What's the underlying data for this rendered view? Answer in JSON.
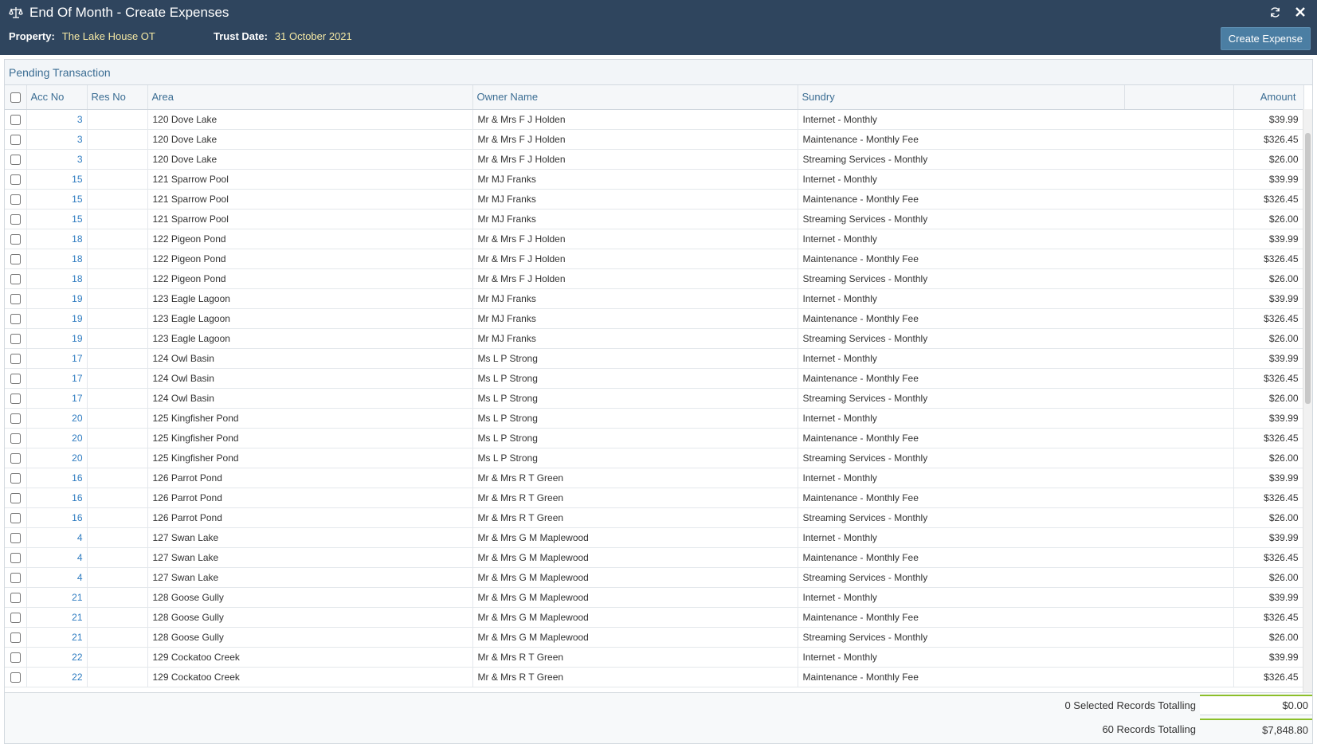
{
  "header": {
    "title": "End Of Month - Create Expenses",
    "property_label": "Property:",
    "property_value": "The Lake House OT",
    "trust_date_label": "Trust Date:",
    "trust_date_value": "31 October 2021",
    "create_button": "Create Expense",
    "icons": [
      "scale-icon",
      "refresh-icon",
      "close-icon"
    ]
  },
  "panel": {
    "title": "Pending Transaction",
    "columns": {
      "acc_no": "Acc No",
      "res_no": "Res No",
      "area": "Area",
      "owner": "Owner Name",
      "sundry": "Sundry",
      "amount": "Amount"
    },
    "rows": [
      {
        "acc": "3",
        "res": "",
        "area": "120 Dove Lake",
        "owner": "Mr & Mrs F J Holden",
        "sundry": "Internet - Monthly",
        "amount": "$39.99"
      },
      {
        "acc": "3",
        "res": "",
        "area": "120 Dove Lake",
        "owner": "Mr & Mrs F J Holden",
        "sundry": "Maintenance - Monthly Fee",
        "amount": "$326.45"
      },
      {
        "acc": "3",
        "res": "",
        "area": "120 Dove Lake",
        "owner": "Mr & Mrs F J Holden",
        "sundry": "Streaming Services - Monthly",
        "amount": "$26.00"
      },
      {
        "acc": "15",
        "res": "",
        "area": "121 Sparrow Pool",
        "owner": "Mr MJ Franks",
        "sundry": "Internet - Monthly",
        "amount": "$39.99"
      },
      {
        "acc": "15",
        "res": "",
        "area": "121 Sparrow Pool",
        "owner": "Mr MJ Franks",
        "sundry": "Maintenance - Monthly Fee",
        "amount": "$326.45"
      },
      {
        "acc": "15",
        "res": "",
        "area": "121 Sparrow Pool",
        "owner": "Mr MJ Franks",
        "sundry": "Streaming Services - Monthly",
        "amount": "$26.00"
      },
      {
        "acc": "18",
        "res": "",
        "area": "122 Pigeon Pond",
        "owner": "Mr & Mrs F J Holden",
        "sundry": "Internet - Monthly",
        "amount": "$39.99"
      },
      {
        "acc": "18",
        "res": "",
        "area": "122 Pigeon Pond",
        "owner": "Mr & Mrs F J Holden",
        "sundry": "Maintenance - Monthly Fee",
        "amount": "$326.45"
      },
      {
        "acc": "18",
        "res": "",
        "area": "122 Pigeon Pond",
        "owner": "Mr & Mrs F J Holden",
        "sundry": "Streaming Services - Monthly",
        "amount": "$26.00"
      },
      {
        "acc": "19",
        "res": "",
        "area": "123 Eagle Lagoon",
        "owner": "Mr MJ Franks",
        "sundry": "Internet - Monthly",
        "amount": "$39.99"
      },
      {
        "acc": "19",
        "res": "",
        "area": "123 Eagle Lagoon",
        "owner": "Mr MJ Franks",
        "sundry": "Maintenance - Monthly Fee",
        "amount": "$326.45"
      },
      {
        "acc": "19",
        "res": "",
        "area": "123 Eagle Lagoon",
        "owner": "Mr MJ Franks",
        "sundry": "Streaming Services - Monthly",
        "amount": "$26.00"
      },
      {
        "acc": "17",
        "res": "",
        "area": "124 Owl Basin",
        "owner": "Ms L P Strong",
        "sundry": "Internet - Monthly",
        "amount": "$39.99"
      },
      {
        "acc": "17",
        "res": "",
        "area": "124 Owl Basin",
        "owner": "Ms L P Strong",
        "sundry": "Maintenance - Monthly Fee",
        "amount": "$326.45"
      },
      {
        "acc": "17",
        "res": "",
        "area": "124 Owl Basin",
        "owner": "Ms L P Strong",
        "sundry": "Streaming Services - Monthly",
        "amount": "$26.00"
      },
      {
        "acc": "20",
        "res": "",
        "area": "125 Kingfisher Pond",
        "owner": "Ms L P Strong",
        "sundry": "Internet - Monthly",
        "amount": "$39.99"
      },
      {
        "acc": "20",
        "res": "",
        "area": "125 Kingfisher Pond",
        "owner": "Ms L P Strong",
        "sundry": "Maintenance - Monthly Fee",
        "amount": "$326.45"
      },
      {
        "acc": "20",
        "res": "",
        "area": "125 Kingfisher Pond",
        "owner": "Ms L P Strong",
        "sundry": "Streaming Services - Monthly",
        "amount": "$26.00"
      },
      {
        "acc": "16",
        "res": "",
        "area": "126 Parrot Pond",
        "owner": "Mr & Mrs R T Green",
        "sundry": "Internet - Monthly",
        "amount": "$39.99"
      },
      {
        "acc": "16",
        "res": "",
        "area": "126 Parrot Pond",
        "owner": "Mr & Mrs R T Green",
        "sundry": "Maintenance - Monthly Fee",
        "amount": "$326.45"
      },
      {
        "acc": "16",
        "res": "",
        "area": "126 Parrot Pond",
        "owner": "Mr & Mrs R T Green",
        "sundry": "Streaming Services - Monthly",
        "amount": "$26.00"
      },
      {
        "acc": "4",
        "res": "",
        "area": "127 Swan Lake",
        "owner": "Mr & Mrs G M Maplewood",
        "sundry": "Internet - Monthly",
        "amount": "$39.99"
      },
      {
        "acc": "4",
        "res": "",
        "area": "127 Swan Lake",
        "owner": "Mr & Mrs G M Maplewood",
        "sundry": "Maintenance - Monthly Fee",
        "amount": "$326.45"
      },
      {
        "acc": "4",
        "res": "",
        "area": "127 Swan Lake",
        "owner": "Mr & Mrs G M Maplewood",
        "sundry": "Streaming Services - Monthly",
        "amount": "$26.00"
      },
      {
        "acc": "21",
        "res": "",
        "area": "128 Goose Gully",
        "owner": "Mr & Mrs G M Maplewood",
        "sundry": "Internet - Monthly",
        "amount": "$39.99"
      },
      {
        "acc": "21",
        "res": "",
        "area": "128 Goose Gully",
        "owner": "Mr & Mrs G M Maplewood",
        "sundry": "Maintenance - Monthly Fee",
        "amount": "$326.45"
      },
      {
        "acc": "21",
        "res": "",
        "area": "128 Goose Gully",
        "owner": "Mr & Mrs G M Maplewood",
        "sundry": "Streaming Services - Monthly",
        "amount": "$26.00"
      },
      {
        "acc": "22",
        "res": "",
        "area": "129 Cockatoo Creek",
        "owner": "Mr & Mrs R T Green",
        "sundry": "Internet - Monthly",
        "amount": "$39.99"
      },
      {
        "acc": "22",
        "res": "",
        "area": "129 Cockatoo Creek",
        "owner": "Mr & Mrs R T Green",
        "sundry": "Maintenance - Monthly Fee",
        "amount": "$326.45"
      }
    ]
  },
  "totals": {
    "selected_label": "0 Selected Records Totalling",
    "selected_value": "$0.00",
    "all_label": "60 Records Totalling",
    "all_value": "$7,848.80"
  },
  "colors": {
    "header_bg": "#2f455e",
    "accent_link": "#2f7cc1",
    "header_value": "#f4e8a4",
    "button_bg": "#4b7ea3",
    "total_underline": "#8cbf2a"
  }
}
